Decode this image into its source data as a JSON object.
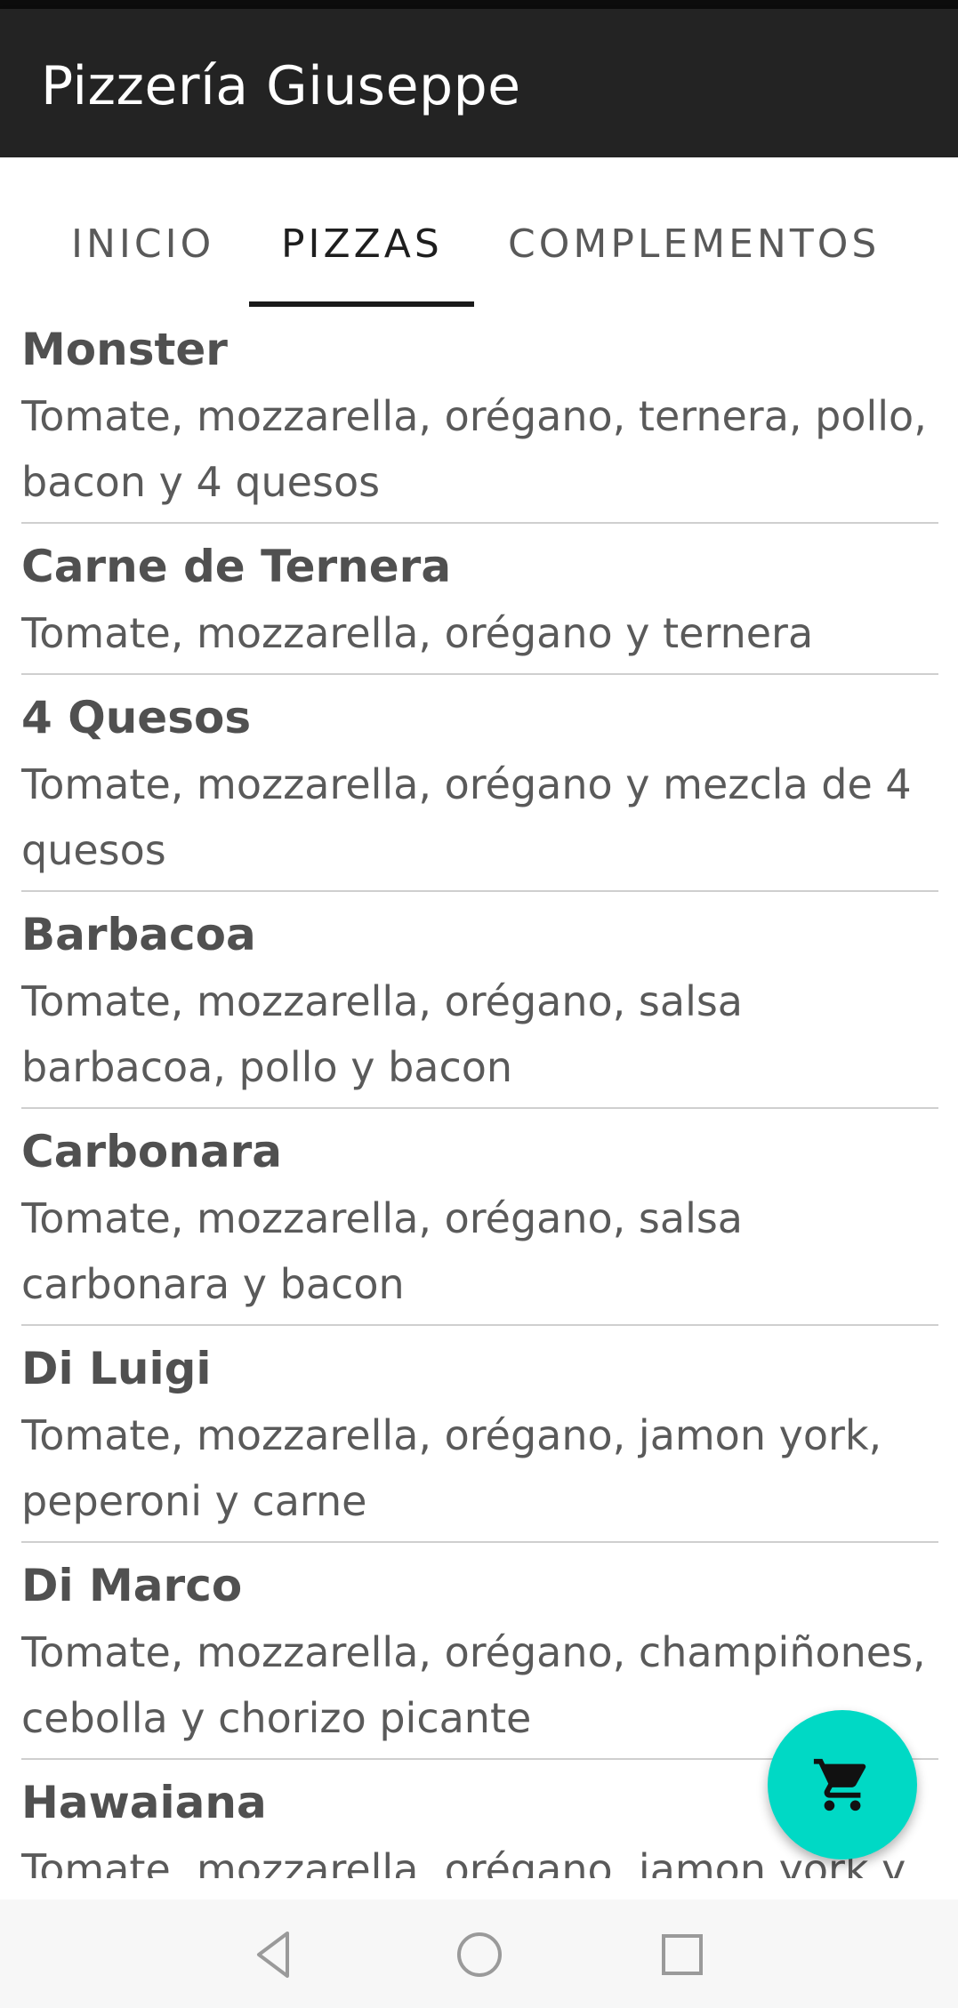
{
  "app": {
    "title": "Pizzería Giuseppe"
  },
  "tabs": [
    {
      "label": "INICIO",
      "active": false
    },
    {
      "label": "PIZZAS",
      "active": true
    },
    {
      "label": "COMPLEMENTOS",
      "active": false
    }
  ],
  "pizzas": [
    {
      "name": "Monster",
      "description": "Tomate, mozzarella, orégano, ternera, pollo, bacon y 4 quesos"
    },
    {
      "name": "Carne de Ternera",
      "description": "Tomate, mozzarella, orégano y ternera"
    },
    {
      "name": "4 Quesos",
      "description": "Tomate, mozzarella, orégano y mezcla de 4 quesos"
    },
    {
      "name": "Barbacoa",
      "description": "Tomate, mozzarella, orégano, salsa barbacoa, pollo y bacon"
    },
    {
      "name": "Carbonara",
      "description": "Tomate, mozzarella, orégano, salsa carbonara y bacon"
    },
    {
      "name": "Di Luigi",
      "description": "Tomate, mozzarella, orégano, jamon york, peperoni y carne"
    },
    {
      "name": "Di Marco",
      "description": "Tomate, mozzarella, orégano, champiñones, cebolla y chorizo picante"
    },
    {
      "name": "Hawaiana",
      "description": "Tomate, mozzarella, orégano, jamon york y"
    }
  ],
  "fab": {
    "icon": "shopping-cart-icon",
    "color": "#00d9c5"
  },
  "nav_bar": {
    "icons": [
      "back-icon",
      "home-icon",
      "recents-icon"
    ]
  },
  "colors": {
    "app_bar": "#232323",
    "accent": "#00d9c5",
    "tab_indicator": "#1a1a1a"
  }
}
